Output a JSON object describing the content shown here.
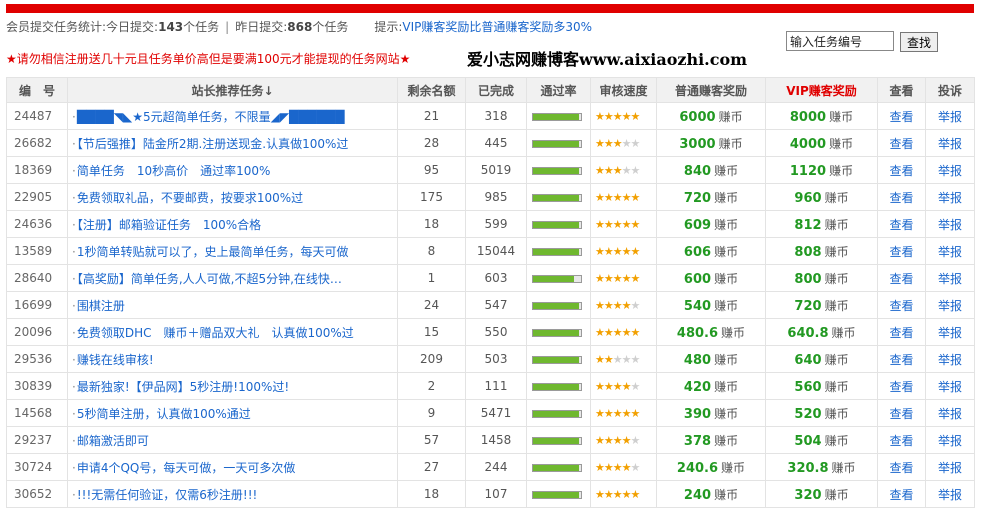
{
  "header": {
    "stats_label": "会员提交任务统计:今日提交:",
    "today_count": "143",
    "today_unit": "个任务",
    "separator": "|",
    "yesterday_label": "昨日提交:",
    "yesterday_count": "868",
    "yesterday_unit": "个任务",
    "tip_label": "提示:",
    "tip_text": "VIP赚客奖励比普通赚客奖励多30%",
    "warning": "★请勿相信注册送几十元且任务单价高但是要满100元才能提现的任务网站★",
    "blog_name": "爱小志网赚博客www.aixiaozhi.com",
    "accent_color": "#e00000"
  },
  "search": {
    "value": "输入任务编号",
    "button": "查找"
  },
  "table": {
    "headers": {
      "id": "编　号",
      "title": "站长推荐任务↓",
      "remaining": "剩余名额",
      "completed": "已完成",
      "pass_rate": "通过率",
      "review_speed": "审核速度",
      "normal_reward": "普通赚客奖励",
      "vip_reward": "VIP赚客奖励",
      "view": "查看",
      "report": "投诉"
    },
    "currency": "赚币",
    "view_label": "查看",
    "report_label": "举报",
    "rows": [
      {
        "id": "24487",
        "title": "████◥◣★5元超简单任务，不限量◢◤██████",
        "remaining": "21",
        "completed": "318",
        "pass_rate": 0.95,
        "stars": 5,
        "normal": "6000",
        "vip": "8000"
      },
      {
        "id": "26682",
        "title": "【节后强推】陆金所2期.注册送现金.认真做100%过",
        "remaining": "28",
        "completed": "445",
        "pass_rate": 0.95,
        "stars": 3,
        "normal": "3000",
        "vip": "4000"
      },
      {
        "id": "18369",
        "title": "简单任务　10秒高价　通过率100%",
        "remaining": "95",
        "completed": "5019",
        "pass_rate": 0.95,
        "stars": 3,
        "normal": "840",
        "vip": "1120"
      },
      {
        "id": "22905",
        "title": "免费领取礼品，不要邮费，按要求100%过",
        "remaining": "175",
        "completed": "985",
        "pass_rate": 0.95,
        "stars": 5,
        "normal": "720",
        "vip": "960"
      },
      {
        "id": "24636",
        "title": "【注册】邮箱验证任务　100%合格",
        "remaining": "18",
        "completed": "599",
        "pass_rate": 0.95,
        "stars": 5,
        "normal": "609",
        "vip": "812"
      },
      {
        "id": "13589",
        "title": "1秒简单转贴就可以了，史上最简单任务，每天可做",
        "remaining": "8",
        "completed": "15044",
        "pass_rate": 0.95,
        "stars": 4.5,
        "normal": "606",
        "vip": "808"
      },
      {
        "id": "28640",
        "title": "【高奖励】简单任务,人人可做,不超5分钟,在线快…",
        "remaining": "1",
        "completed": "603",
        "pass_rate": 0.85,
        "stars": 4.5,
        "normal": "600",
        "vip": "800"
      },
      {
        "id": "16699",
        "title": "围棋注册",
        "remaining": "24",
        "completed": "547",
        "pass_rate": 0.95,
        "stars": 4,
        "normal": "540",
        "vip": "720"
      },
      {
        "id": "20096",
        "title": "免费领取DHC　赚币＋赠品双大礼　认真做100%过",
        "remaining": "15",
        "completed": "550",
        "pass_rate": 0.95,
        "stars": 4.5,
        "normal": "480.6",
        "vip": "640.8"
      },
      {
        "id": "29536",
        "title": "赚钱在线审核!",
        "remaining": "209",
        "completed": "503",
        "pass_rate": 0.95,
        "stars": 2,
        "normal": "480",
        "vip": "640"
      },
      {
        "id": "30839",
        "title": "最新独家!【伊品网】5秒注册!100%过!",
        "remaining": "2",
        "completed": "111",
        "pass_rate": 0.95,
        "stars": 3.5,
        "normal": "420",
        "vip": "560"
      },
      {
        "id": "14568",
        "title": "5秒简单注册，认真做100%通过",
        "remaining": "9",
        "completed": "5471",
        "pass_rate": 0.95,
        "stars": 4.5,
        "normal": "390",
        "vip": "520"
      },
      {
        "id": "29237",
        "title": "邮箱激活即可",
        "remaining": "57",
        "completed": "1458",
        "pass_rate": 0.95,
        "stars": 4,
        "normal": "378",
        "vip": "504"
      },
      {
        "id": "30724",
        "title": "申请4个QQ号，每天可做，一天可多次做",
        "remaining": "27",
        "completed": "244",
        "pass_rate": 0.95,
        "stars": 4,
        "normal": "240.6",
        "vip": "320.8"
      },
      {
        "id": "30652",
        "title": "!!!无需任何验证，仅需6秒注册!!!",
        "remaining": "18",
        "completed": "107",
        "pass_rate": 0.95,
        "stars": 4.5,
        "normal": "240",
        "vip": "320"
      }
    ]
  }
}
